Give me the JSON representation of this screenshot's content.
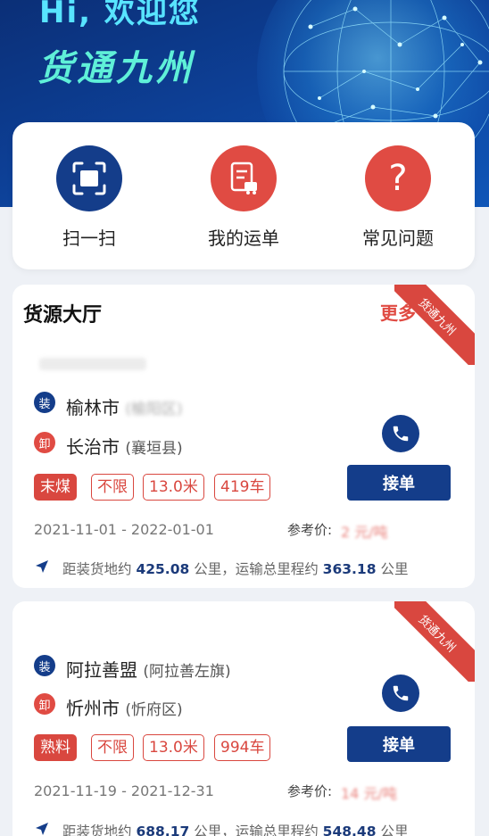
{
  "hero": {
    "greeting": "Hi, 欢迎您",
    "brand": "货通九州"
  },
  "quick": [
    {
      "label": "扫一扫",
      "icon": "scan-icon",
      "color": "#143d8a"
    },
    {
      "label": "我的运单",
      "icon": "waybill-icon",
      "color": "#e04b43"
    },
    {
      "label": "常见问题",
      "icon": "question-icon",
      "color": "#e04b43"
    }
  ],
  "hall": {
    "title": "货源大厅",
    "more": "更多"
  },
  "orders": [
    {
      "ribbon": "货通九州",
      "load_badge": "装",
      "unload_badge": "卸",
      "load_city": "榆林市",
      "load_district": "(榆阳区)",
      "unload_city": "长治市",
      "unload_district": "(襄垣县)",
      "tags": [
        "末煤",
        "不限",
        "13.0米",
        "419车"
      ],
      "date_range": "2021-11-01 - 2022-01-01",
      "ref_label": "参考价:",
      "ref_value": "2 元/吨",
      "dist_prefix": "距装货地约",
      "dist_load": "425.08",
      "dist_mid": "公里，运输总里程约",
      "dist_total": "363.18",
      "dist_unit": "公里",
      "accept": "接单"
    },
    {
      "ribbon": "货通九州",
      "load_badge": "装",
      "unload_badge": "卸",
      "load_city": "阿拉善盟",
      "load_district": "(阿拉善左旗)",
      "unload_city": "忻州市",
      "unload_district": "(忻府区)",
      "tags": [
        "熟料",
        "不限",
        "13.0米",
        "994车"
      ],
      "date_range": "2021-11-19 - 2021-12-31",
      "ref_label": "参考价:",
      "ref_value": "14 元/吨",
      "dist_prefix": "距装货地约",
      "dist_load": "688.17",
      "dist_mid": "公里，运输总里程约",
      "dist_total": "548.48",
      "dist_unit": "公里",
      "accept": "接单"
    }
  ]
}
